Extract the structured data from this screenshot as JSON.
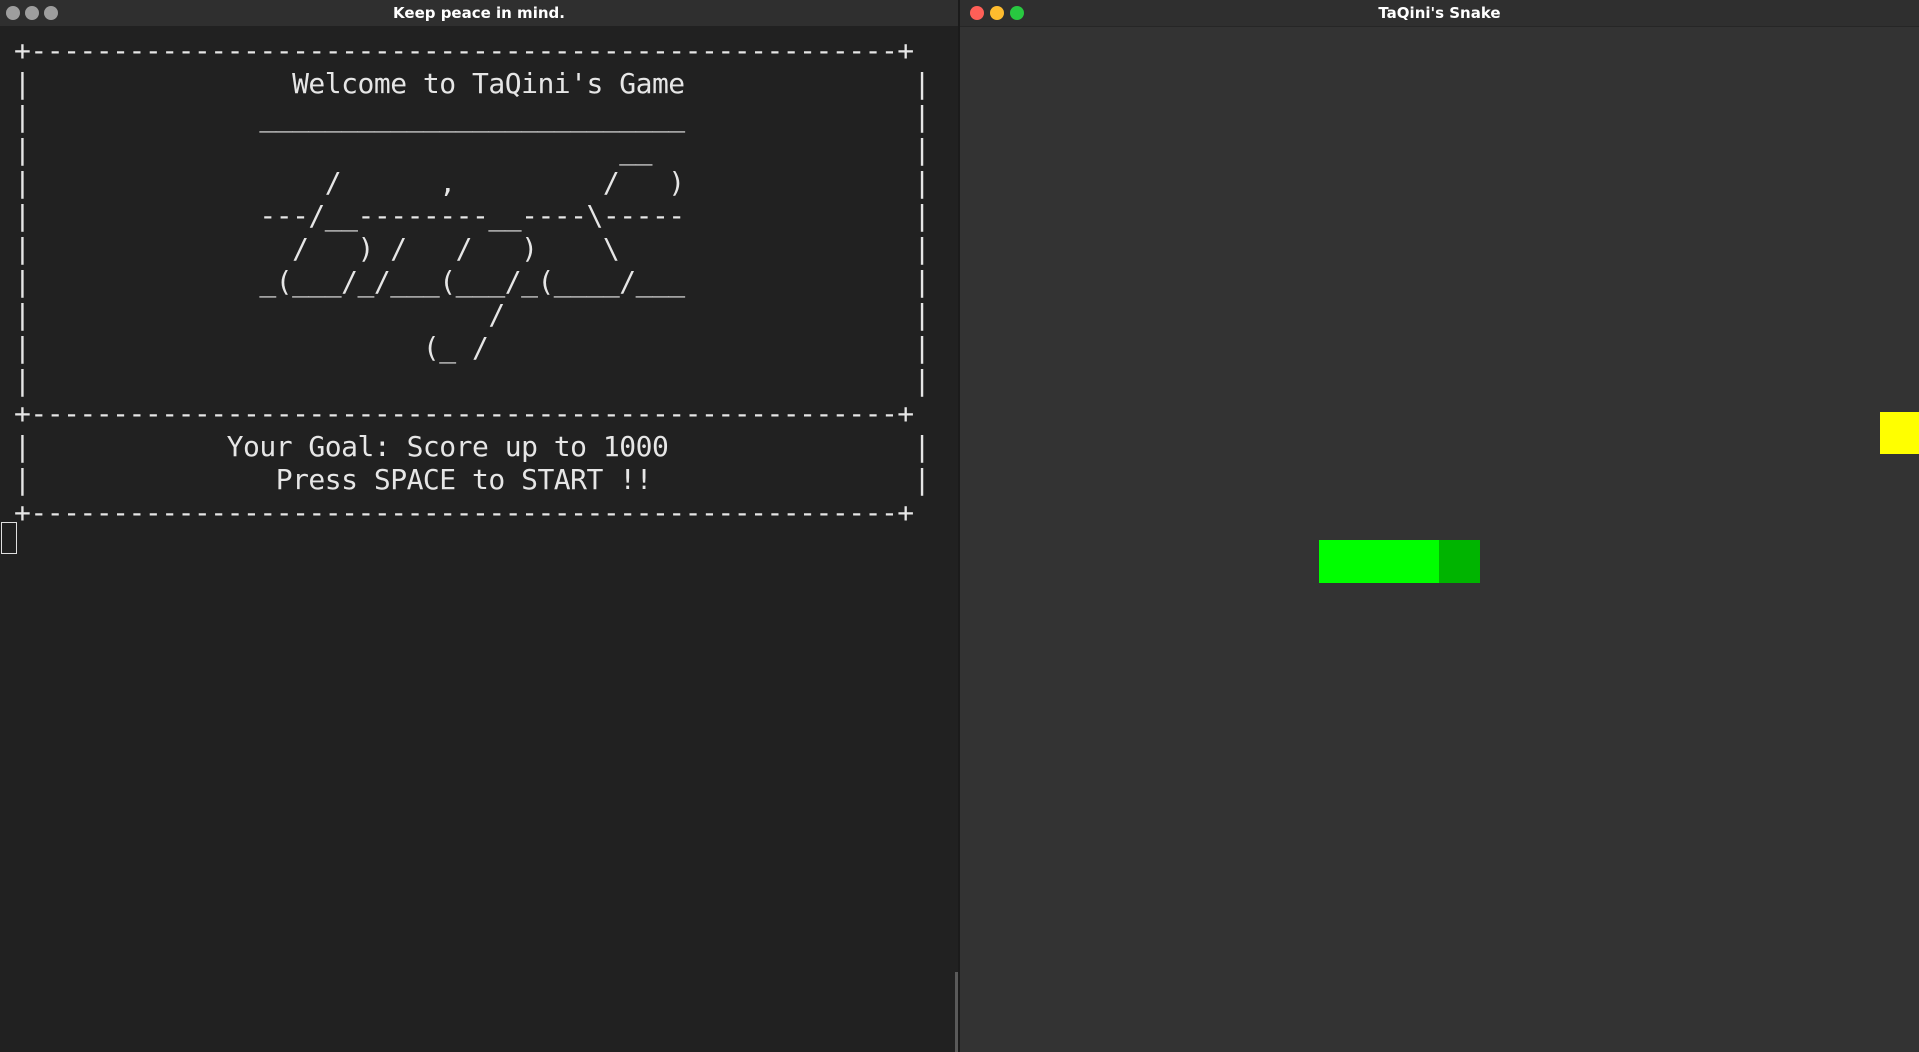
{
  "terminal": {
    "title": "Keep peace in mind.",
    "screen_lines": [
      "+-----------------------------------------------------+",
      "|                Welcome to TaQini's Game              |",
      "|              __________________________              |",
      "|                                    __                |",
      "|                  /      ,         /   )              |",
      "|              ---/__--------__----\\-----              |",
      "|                /   ) /   /   )    \\                  |",
      "|              _(___/_/___(___/_(____/___              |",
      "|                            /                         |",
      "|                        (_ /                          |",
      "|                                                      |",
      "+-----------------------------------------------------+",
      "|            Your Goal: Score up to 1000               |",
      "|               Press SPACE to START !!                |",
      "+-----------------------------------------------------+"
    ]
  },
  "game": {
    "title": "TaQini's Snake",
    "colors": {
      "background": "#333333",
      "snake_body": "#00ff00",
      "snake_head": "#00b400",
      "food": "#ffff00",
      "close": "#ff5f57",
      "minimize": "#febc2e",
      "maximize": "#28c840"
    }
  }
}
